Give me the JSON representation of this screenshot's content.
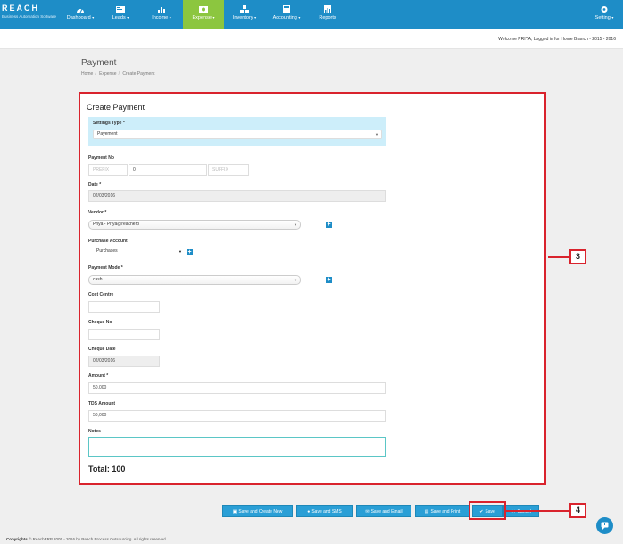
{
  "brand": {
    "name": "REACH",
    "tagline": "Business Automation Software"
  },
  "nav": {
    "items": [
      {
        "label": "Dashboard",
        "icon": "dashboard-icon"
      },
      {
        "label": "Leads",
        "icon": "leads-icon"
      },
      {
        "label": "Income",
        "icon": "bar-chart-icon"
      },
      {
        "label": "Expense",
        "icon": "money-icon"
      },
      {
        "label": "Inventory",
        "icon": "cubes-icon"
      },
      {
        "label": "Accounting",
        "icon": "calculator-icon"
      },
      {
        "label": "Reports",
        "icon": "reports-icon"
      }
    ],
    "setting_label": "Setting",
    "active_color": "#8cc63f",
    "bar_color": "#1e8dc7"
  },
  "welcome": "Welcome PRIYA, Logged in for Home Branch - 2015 - 2016",
  "page": {
    "title": "Payment",
    "breadcrumb": [
      "Home",
      "Expense",
      "Create Payment"
    ]
  },
  "form": {
    "title": "Create Payment",
    "settings_type": {
      "label": "Settings Type",
      "value": "Payement"
    },
    "payment_no": {
      "label": "Payment No",
      "prefix_placeholder": "PREFIX",
      "number": "0",
      "suffix_placeholder": "SUFFIX"
    },
    "date": {
      "label": "Date",
      "value": "02/03/2016"
    },
    "vendor": {
      "label": "Vendor",
      "value": "Priya - Priya@reacherp"
    },
    "purchase_account": {
      "label": "Purchase Account",
      "value": "Purchases"
    },
    "payment_mode": {
      "label": "Payment Mode",
      "value": "cash"
    },
    "cost_centre": {
      "label": "Cost Centre",
      "value": ""
    },
    "cheque_no": {
      "label": "Cheque No",
      "value": ""
    },
    "cheque_date": {
      "label": "Cheque Date",
      "value": "02/03/2016"
    },
    "amount": {
      "label": "Amount",
      "value": "50,000"
    },
    "tds_amount": {
      "label": "TDS Amount",
      "value": "50,000"
    },
    "notes": {
      "label": "Notes",
      "value": ""
    },
    "total": "Total: 100",
    "required_mark": "*"
  },
  "actions": {
    "save_and_create_new": "Save and Create New",
    "save_and_sms": "Save and SMS",
    "save_and_email": "Save and Email",
    "save_and_print": "Save and Print",
    "save": "Save",
    "cancel": "Cancel"
  },
  "callouts": {
    "panel": "3",
    "save": "4"
  },
  "footer": {
    "copyright_label": "Copyrights",
    "text": "© ReachERP 2005 - 2016 by Reach Process Outsourcing. All rights reserved."
  }
}
